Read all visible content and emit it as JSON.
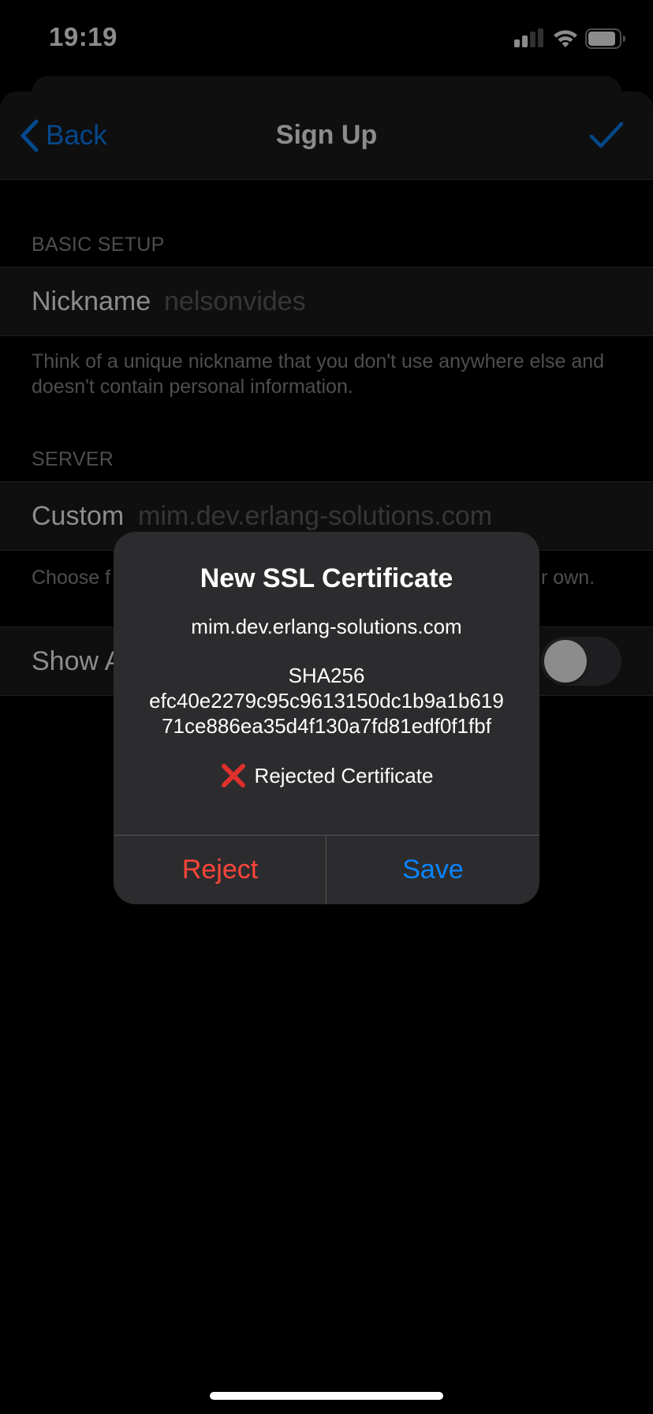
{
  "status_bar": {
    "time": "19:19",
    "signal_icon": "cellular-signal-icon",
    "wifi_icon": "wifi-icon",
    "battery_icon": "battery-icon"
  },
  "nav": {
    "back_label": "Back",
    "title": "Sign Up",
    "done_icon": "checkmark-icon"
  },
  "sections": {
    "basic_setup": {
      "header": "BASIC SETUP",
      "nickname_label": "Nickname",
      "nickname_value": "nelsonvides",
      "footer": "Think of a unique nickname that you don't use anywhere else and doesn't contain personal information."
    },
    "server": {
      "header": "SERVER",
      "custom_label": "Custom",
      "custom_value": "mim.dev.erlang-solutions.com",
      "footer_left": "Choose f",
      "footer_right": "r own.",
      "show_label": "Show A",
      "toggle_on": false
    }
  },
  "alert": {
    "title": "New SSL Certificate",
    "domain": "mim.dev.erlang-solutions.com",
    "hash_type": "SHA256",
    "hash_line1": "efc40e2279c95c9613150dc1b9a1b619",
    "hash_line2": "71ce886ea35d4f130a7fd81edf0f1fbf",
    "status_icon": "red-x-icon",
    "status_text": "Rejected Certificate",
    "reject_label": "Reject",
    "save_label": "Save"
  },
  "colors": {
    "accent": "#0a84ff",
    "destructive": "#ff453a",
    "background": "#000000",
    "cell": "#1c1c1e",
    "alert": "#2c2c2e"
  }
}
